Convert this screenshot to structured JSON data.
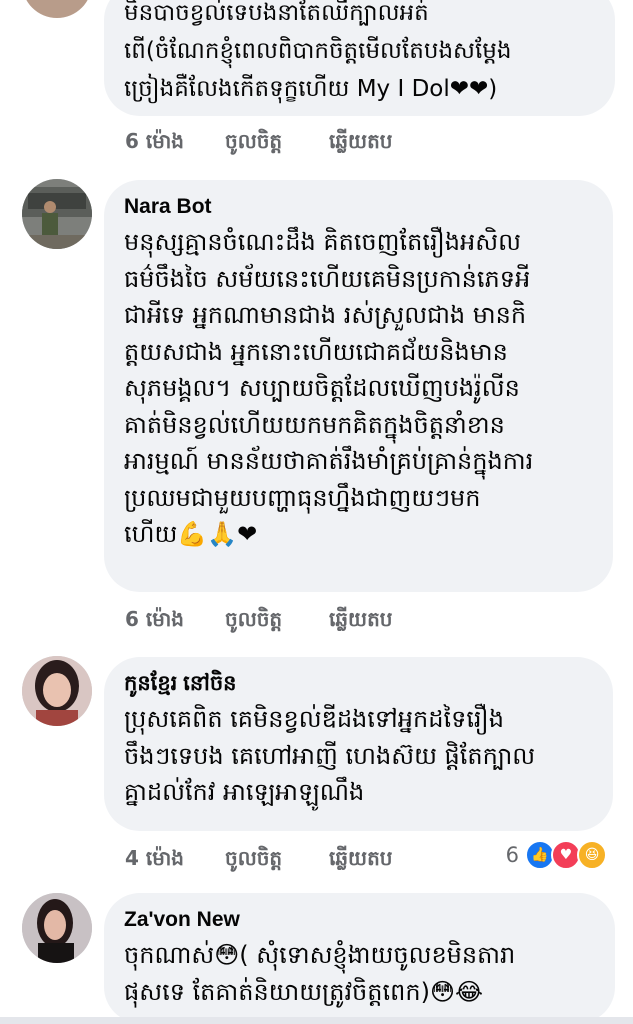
{
  "comments": [
    {
      "author": "",
      "text": "មិនបាចខ្វល់ទេបងនាតែឈឺក្បាលអត់\nពើ(ចំណែកខ្ញុំពេលពិបាកចិត្តមើលតែបងសម្ដែង\nច្រៀងគឺលែងកើតទុក្ខហើយ My I Dol❤❤)",
      "time": "6 ម៉ោង",
      "like": "ចូលចិត្ត",
      "reply": "ឆ្លើយតប"
    },
    {
      "author": "Nara Bot",
      "text": "មនុស្សគ្មានចំណេះដឹង គិតចេញតែរឿងអសិល\nធម៌ចឹងចៃ សម័យនេះហើយគេមិនប្រកាន់ភេទអី\nជាអីទេ អ្នកណាមានជាង រស់ស្រួលជាង មានកិ\nត្តយសជាង អ្នកនោះហើយជោគជ័យនិងមាន\nសុភមង្គល។ សប្បាយចិត្តដែលឃើញបងរ៉ូលីន\nគាត់មិនខ្វល់ហើយយកមកគិតក្នុងចិត្តនាំខាន\nអារម្មណ៍ មានន័យថាគាត់រឹងមាំគ្រប់គ្រាន់ក្នុងការ\nប្រឈមជាមួយបញ្ហាធុនហ្នឹងជាញយៗមក\nហើយ💪🙏❤",
      "time": "6 ម៉ោង",
      "like": "ចូលចិត្ត",
      "reply": "ឆ្លើយតប"
    },
    {
      "author": "កូនខ្មែរ នៅចិន",
      "text": "ប្រុសគេពិត គេមិនខ្វល់ឌីដងទៅអ្នកដទៃរឿង\nចឹងៗទេបង គេហៅអាញី ហេងស៊យ ផ្ដិតែក្បាល\nគ្នាដល់កែវ អាឡេអាឡូណឹង",
      "time": "4 ម៉ោង",
      "like": "ចូលចិត្ត",
      "reply": "ឆ្លើយតប",
      "reaction_count": "6"
    },
    {
      "author": "Za'von New",
      "text": "ចុកណាស់😳( សុំទោសខ្ញុំងាយចូលខមិនតារា\nផុសទេ តែគាត់និយាយត្រូវចិត្តពេក)😳😂",
      "time": "",
      "like": "",
      "reply": ""
    }
  ],
  "icons": {
    "reactions": [
      "like-icon",
      "love-icon",
      "haha-icon"
    ]
  }
}
